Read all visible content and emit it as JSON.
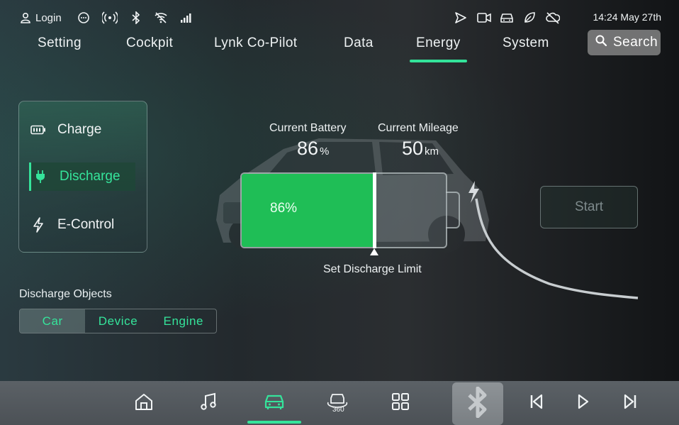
{
  "status_bar": {
    "login_label": "Login",
    "icons": [
      "user-icon",
      "message-icon",
      "hotspot-icon",
      "bluetooth-icon",
      "wifi-off-icon",
      "signal-icon",
      "navigation-icon",
      "camera-icon",
      "car-status-icon",
      "eco-leaf-icon",
      "cloud-off-icon"
    ],
    "clock": "14:24 May 27th"
  },
  "nav": {
    "tabs": [
      {
        "label": "Setting"
      },
      {
        "label": "Cockpit"
      },
      {
        "label": "Lynk Co-Pilot"
      },
      {
        "label": "Data"
      },
      {
        "label": "Energy",
        "active": true
      },
      {
        "label": "System"
      }
    ],
    "search_label": "Search"
  },
  "side_menu": {
    "items": [
      {
        "label": "Charge",
        "icon": "battery-icon"
      },
      {
        "label": "Discharge",
        "icon": "plug-icon",
        "active": true
      },
      {
        "label": "E-Control",
        "icon": "lightning-icon"
      }
    ]
  },
  "discharge_objects": {
    "label": "Discharge Objects",
    "options": [
      "Car",
      "Device",
      "Engine"
    ],
    "selected": "Car"
  },
  "battery_panel": {
    "battery_label": "Current Battery",
    "battery_value": "86",
    "battery_unit": "%",
    "mileage_label": "Current Mileage",
    "mileage_value": "50",
    "mileage_unit": "km",
    "fill_text": "86%",
    "level": 0.86,
    "discharge_limit": 0.65,
    "limit_label": "Set Discharge Limit"
  },
  "start_button": {
    "label": "Start",
    "enabled": false
  },
  "dock": {
    "items": [
      "home-icon",
      "music-icon",
      "car-icon",
      "camera-360-icon",
      "apps-grid-icon",
      "bluetooth-icon",
      "previous-track-icon",
      "play-icon",
      "next-track-icon"
    ],
    "active": "car-icon",
    "camera_label": "360"
  },
  "colors": {
    "accent": "#35e49b",
    "battery_fill": "#1fbe56",
    "search_bg": "#969696"
  }
}
